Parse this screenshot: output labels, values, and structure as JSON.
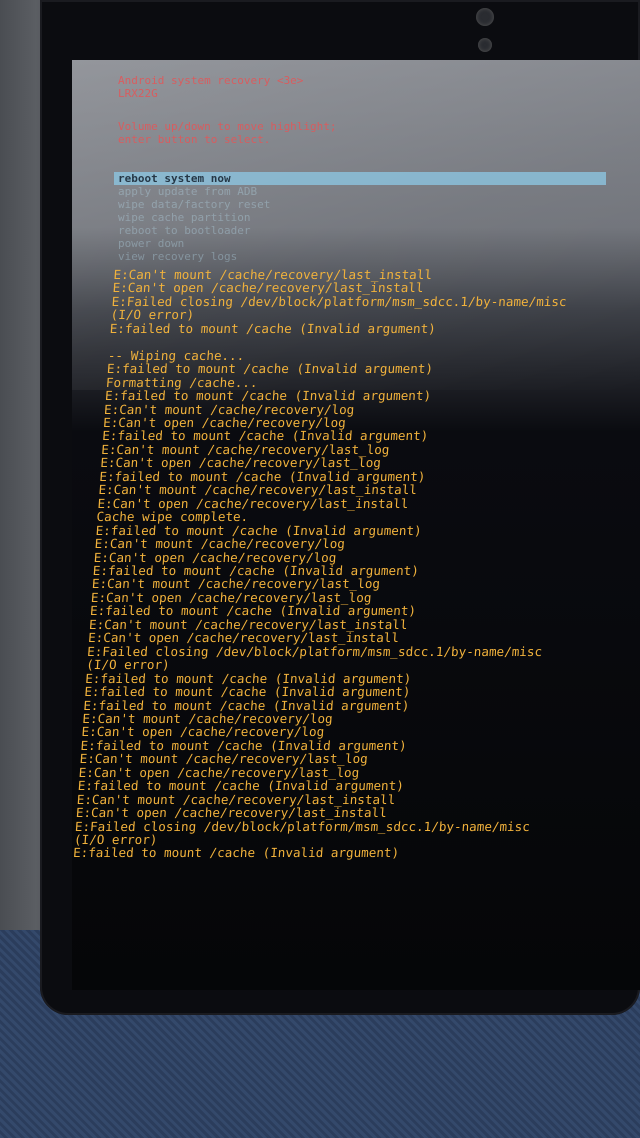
{
  "header": {
    "title": "Android system recovery <3e>",
    "build": "LRX22G",
    "help_line1": "Volume up/down to move highlight;",
    "help_line2": "enter button to select."
  },
  "menu": {
    "items": [
      {
        "label": "reboot system now",
        "selected": true
      },
      {
        "label": "apply update from ADB",
        "selected": false
      },
      {
        "label": "wipe data/factory reset",
        "selected": false
      },
      {
        "label": "wipe cache partition",
        "selected": false
      },
      {
        "label": "reboot to bootloader",
        "selected": false
      },
      {
        "label": "power down",
        "selected": false
      },
      {
        "label": "view recovery logs",
        "selected": false
      }
    ]
  },
  "log": {
    "lines": [
      "E:Can't mount /cache/recovery/last_install",
      "E:Can't open /cache/recovery/last_install",
      "E:Failed closing /dev/block/platform/msm_sdcc.1/by-name/misc",
      "(I/O error)",
      "E:failed to mount /cache (Invalid argument)",
      "",
      "-- Wiping cache...",
      "E:failed to mount /cache (Invalid argument)",
      "Formatting /cache...",
      "E:failed to mount /cache (Invalid argument)",
      "E:Can't mount /cache/recovery/log",
      "E:Can't open /cache/recovery/log",
      "E:failed to mount /cache (Invalid argument)",
      "E:Can't mount /cache/recovery/last_log",
      "E:Can't open /cache/recovery/last_log",
      "E:failed to mount /cache (Invalid argument)",
      "E:Can't mount /cache/recovery/last_install",
      "E:Can't open /cache/recovery/last_install",
      "Cache wipe complete.",
      "E:failed to mount /cache (Invalid argument)",
      "E:Can't mount /cache/recovery/log",
      "E:Can't open /cache/recovery/log",
      "E:failed to mount /cache (Invalid argument)",
      "E:Can't mount /cache/recovery/last_log",
      "E:Can't open /cache/recovery/last_log",
      "E:failed to mount /cache (Invalid argument)",
      "E:Can't mount /cache/recovery/last_install",
      "E:Can't open /cache/recovery/last_install",
      "E:Failed closing /dev/block/platform/msm_sdcc.1/by-name/misc",
      "(I/O error)",
      "E:failed to mount /cache (Invalid argument)",
      "E:failed to mount /cache (Invalid argument)",
      "E:failed to mount /cache (Invalid argument)",
      "E:Can't mount /cache/recovery/log",
      "E:Can't open /cache/recovery/log",
      "E:failed to mount /cache (Invalid argument)",
      "E:Can't mount /cache/recovery/last_log",
      "E:Can't open /cache/recovery/last_log",
      "E:failed to mount /cache (Invalid argument)",
      "E:Can't mount /cache/recovery/last_install",
      "E:Can't open /cache/recovery/last_install",
      "E:Failed closing /dev/block/platform/msm_sdcc.1/by-name/misc",
      "(I/O error)",
      "E:failed to mount /cache (Invalid argument)"
    ]
  },
  "colors": {
    "header_text": "#e0585a",
    "log_text": "#f1b23c",
    "menu_highlight": "#8cc4e0"
  }
}
